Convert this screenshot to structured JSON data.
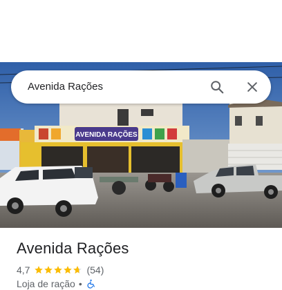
{
  "search": {
    "query": "Avenida Rações",
    "search_icon": "search-icon",
    "close_icon": "close-icon"
  },
  "hero": {
    "store_sign_text": "AVENIDA RAÇÕES",
    "image_subject": "storefront-photo"
  },
  "place": {
    "name": "Avenida Rações",
    "rating": "4,7",
    "stars_rating": 4.7,
    "review_count": "(54)",
    "category": "Loja de ração",
    "separator": "•",
    "accessibility_icon": "wheelchair-icon"
  },
  "colors": {
    "star": "#fbbc04",
    "accessibility": "#1a73e8",
    "text_primary": "#202124",
    "text_secondary": "#5f6368"
  }
}
